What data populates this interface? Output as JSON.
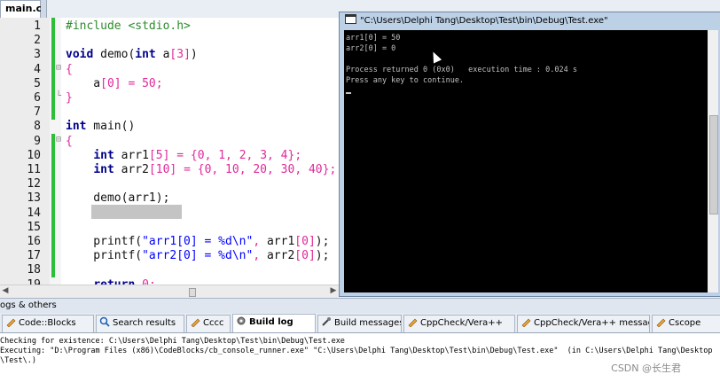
{
  "editor": {
    "file_tab": "main.c",
    "lines": [
      {
        "n": "1",
        "tokens": [
          {
            "c": "pp",
            "t": "#include <stdio.h>"
          }
        ]
      },
      {
        "n": "2",
        "tokens": []
      },
      {
        "n": "3",
        "tokens": [
          {
            "c": "kw",
            "t": "void"
          },
          {
            "c": "",
            "t": " demo("
          },
          {
            "c": "kw",
            "t": "int"
          },
          {
            "c": "",
            "t": " a"
          },
          {
            "c": "op",
            "t": "["
          },
          {
            "c": "num",
            "t": "3"
          },
          {
            "c": "op",
            "t": "]"
          },
          {
            "c": "",
            "t": ")"
          }
        ]
      },
      {
        "n": "4",
        "tokens": [
          {
            "c": "op",
            "t": "{"
          }
        ]
      },
      {
        "n": "5",
        "tokens": [
          {
            "c": "",
            "t": "    a"
          },
          {
            "c": "op",
            "t": "["
          },
          {
            "c": "num",
            "t": "0"
          },
          {
            "c": "op",
            "t": "]"
          },
          {
            "c": "",
            "t": " "
          },
          {
            "c": "op",
            "t": "="
          },
          {
            "c": "",
            "t": " "
          },
          {
            "c": "num",
            "t": "50"
          },
          {
            "c": "op",
            "t": ";"
          }
        ]
      },
      {
        "n": "6",
        "tokens": [
          {
            "c": "op",
            "t": "}"
          }
        ]
      },
      {
        "n": "7",
        "tokens": []
      },
      {
        "n": "8",
        "tokens": [
          {
            "c": "kw",
            "t": "int"
          },
          {
            "c": "",
            "t": " main()"
          }
        ]
      },
      {
        "n": "9",
        "tokens": [
          {
            "c": "op",
            "t": "{"
          }
        ]
      },
      {
        "n": "10",
        "tokens": [
          {
            "c": "",
            "t": "    "
          },
          {
            "c": "kw",
            "t": "int"
          },
          {
            "c": "",
            "t": " arr1"
          },
          {
            "c": "op",
            "t": "["
          },
          {
            "c": "num",
            "t": "5"
          },
          {
            "c": "op",
            "t": "]"
          },
          {
            "c": "",
            "t": " "
          },
          {
            "c": "op",
            "t": "="
          },
          {
            "c": "",
            "t": " "
          },
          {
            "c": "op",
            "t": "{"
          },
          {
            "c": "num",
            "t": "0"
          },
          {
            "c": "op",
            "t": ","
          },
          {
            "c": "",
            "t": " "
          },
          {
            "c": "num",
            "t": "1"
          },
          {
            "c": "op",
            "t": ","
          },
          {
            "c": "",
            "t": " "
          },
          {
            "c": "num",
            "t": "2"
          },
          {
            "c": "op",
            "t": ","
          },
          {
            "c": "",
            "t": " "
          },
          {
            "c": "num",
            "t": "3"
          },
          {
            "c": "op",
            "t": ","
          },
          {
            "c": "",
            "t": " "
          },
          {
            "c": "num",
            "t": "4"
          },
          {
            "c": "op",
            "t": "};"
          },
          {
            "c": "",
            "t": "      "
          },
          {
            "c": "cm",
            "t": "//"
          }
        ]
      },
      {
        "n": "11",
        "tokens": [
          {
            "c": "",
            "t": "    "
          },
          {
            "c": "kw",
            "t": "int"
          },
          {
            "c": "",
            "t": " arr2"
          },
          {
            "c": "op",
            "t": "["
          },
          {
            "c": "num",
            "t": "10"
          },
          {
            "c": "op",
            "t": "]"
          },
          {
            "c": "",
            "t": " "
          },
          {
            "c": "op",
            "t": "="
          },
          {
            "c": "",
            "t": " "
          },
          {
            "c": "op",
            "t": "{"
          },
          {
            "c": "num",
            "t": "0"
          },
          {
            "c": "op",
            "t": ","
          },
          {
            "c": "",
            "t": " "
          },
          {
            "c": "num",
            "t": "10"
          },
          {
            "c": "op",
            "t": ","
          },
          {
            "c": "",
            "t": " "
          },
          {
            "c": "num",
            "t": "20"
          },
          {
            "c": "op",
            "t": ","
          },
          {
            "c": "",
            "t": " "
          },
          {
            "c": "num",
            "t": "30"
          },
          {
            "c": "op",
            "t": ","
          },
          {
            "c": "",
            "t": " "
          },
          {
            "c": "num",
            "t": "40"
          },
          {
            "c": "op",
            "t": "};"
          },
          {
            "c": "",
            "t": " "
          },
          {
            "c": "cm",
            "t": "//"
          }
        ]
      },
      {
        "n": "12",
        "tokens": []
      },
      {
        "n": "13",
        "tokens": [
          {
            "c": "",
            "t": "    demo(arr1);"
          }
        ]
      },
      {
        "n": "14",
        "tokens": []
      },
      {
        "n": "15",
        "tokens": []
      },
      {
        "n": "16",
        "tokens": [
          {
            "c": "",
            "t": "    printf("
          },
          {
            "c": "str",
            "t": "\"arr1[0] = %d\\n\""
          },
          {
            "c": "op",
            "t": ","
          },
          {
            "c": "",
            "t": " arr1"
          },
          {
            "c": "op",
            "t": "["
          },
          {
            "c": "num",
            "t": "0"
          },
          {
            "c": "op",
            "t": "]"
          },
          {
            "c": "",
            "t": ");"
          }
        ]
      },
      {
        "n": "17",
        "tokens": [
          {
            "c": "",
            "t": "    printf("
          },
          {
            "c": "str",
            "t": "\"arr2[0] = %d\\n\""
          },
          {
            "c": "op",
            "t": ","
          },
          {
            "c": "",
            "t": " arr2"
          },
          {
            "c": "op",
            "t": "["
          },
          {
            "c": "num",
            "t": "0"
          },
          {
            "c": "op",
            "t": "]"
          },
          {
            "c": "",
            "t": ");"
          }
        ]
      },
      {
        "n": "18",
        "tokens": []
      },
      {
        "n": "19",
        "tokens": [
          {
            "c": "",
            "t": "    "
          },
          {
            "c": "kw",
            "t": "return"
          },
          {
            "c": "",
            "t": " "
          },
          {
            "c": "num",
            "t": "0"
          },
          {
            "c": "op",
            "t": ";"
          }
        ]
      }
    ]
  },
  "console": {
    "title": "\"C:\\Users\\Delphi Tang\\Desktop\\Test\\bin\\Debug\\Test.exe\"",
    "lines": [
      "arr1[0] = 50",
      "arr2[0] = 0",
      "",
      "Process returned 0 (0x0)   execution time : 0.024 s",
      "Press any key to continue."
    ]
  },
  "logs": {
    "panel_title": "ogs & others",
    "tabs": [
      {
        "label": "Code::Blocks",
        "icon": "pencil-icon",
        "active": false
      },
      {
        "label": "Search results",
        "icon": "search-icon",
        "active": false
      },
      {
        "label": "Cccc",
        "icon": "pencil-icon",
        "active": false
      },
      {
        "label": "Build log",
        "icon": "gear-icon",
        "active": true
      },
      {
        "label": "Build messages",
        "icon": "build-messages-icon",
        "active": false
      },
      {
        "label": "CppCheck/Vera++",
        "icon": "pencil-icon",
        "active": false
      },
      {
        "label": "CppCheck/Vera++ messages",
        "icon": "pencil-icon",
        "active": false
      },
      {
        "label": "Cscope",
        "icon": "pencil-icon",
        "active": false
      }
    ],
    "lines": [
      "Checking for existence: C:\\Users\\Delphi Tang\\Desktop\\Test\\bin\\Debug\\Test.exe",
      "Executing: \"D:\\Program Files (x86)\\CodeBlocks/cb_console_runner.exe\" \"C:\\Users\\Delphi Tang\\Desktop\\Test\\bin\\Debug\\Test.exe\"  (in C:\\Users\\Delphi Tang\\Desktop",
      "\\Test\\.)"
    ]
  },
  "watermark": "CSDN @长生君",
  "colors": {
    "accent_green": "#2dbf3a",
    "console_bg": "#000000",
    "keyword": "#00008b",
    "number": "#e0289a",
    "string": "#0000ff"
  }
}
